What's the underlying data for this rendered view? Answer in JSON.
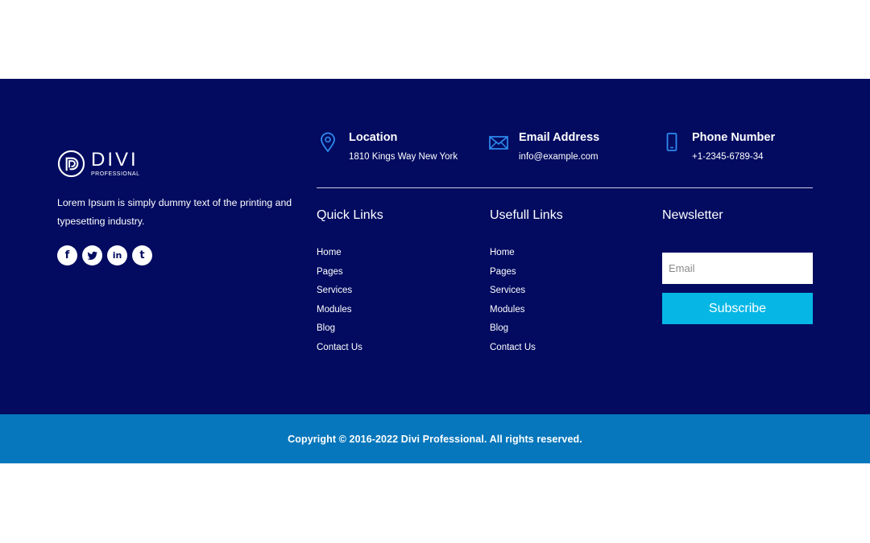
{
  "brand": {
    "name": "DIVI",
    "subtitle": "PROFESSIONAL",
    "about": "Lorem Ipsum is simply dummy text of the printing and typesetting industry."
  },
  "socials": [
    {
      "label": "f",
      "icon": "facebook-icon"
    },
    {
      "label": "twitter",
      "icon": "twitter-icon"
    },
    {
      "label": "in",
      "icon": "linkedin-icon"
    },
    {
      "label": "t",
      "icon": "tumblr-icon"
    }
  ],
  "contact": {
    "location": {
      "title": "Location",
      "value": "1810 Kings Way New York",
      "icon": "location-pin-icon"
    },
    "email": {
      "title": "Email Address",
      "value": "info@example.com",
      "icon": "envelope-icon"
    },
    "phone": {
      "title": "Phone Number",
      "value": "+1-2345-6789-34",
      "icon": "phone-icon"
    }
  },
  "quick_links": {
    "title": "Quick Links",
    "items": [
      "Home",
      "Pages",
      "Services",
      "Modules",
      "Blog",
      "Contact Us"
    ]
  },
  "useful_links": {
    "title": "Usefull Links",
    "items": [
      "Home",
      "Pages",
      "Services",
      "Modules",
      "Blog",
      "Contact Us"
    ]
  },
  "newsletter": {
    "title": "Newsletter",
    "placeholder": "Email",
    "button": "Subscribe"
  },
  "copyright": "Copyright © 2016-2022 Divi Professional. All rights reserved.",
  "colors": {
    "footer_bg": "#020b60",
    "bottom_bar": "#0677bc",
    "accent": "#06b7e6",
    "icon_blue": "#2e8bf0"
  }
}
